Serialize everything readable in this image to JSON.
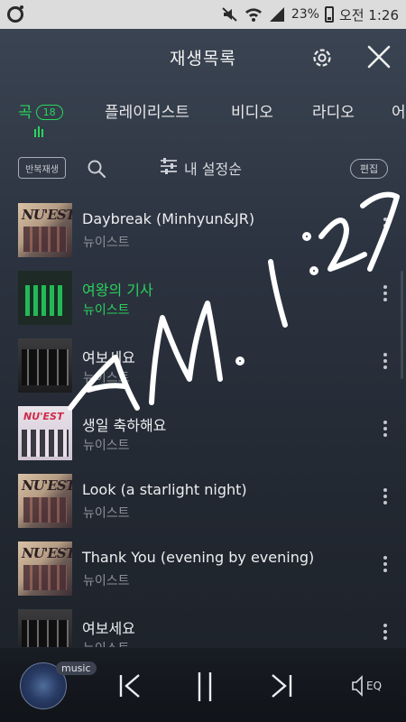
{
  "status_bar": {
    "battery": "23%",
    "time": "오전 1:26"
  },
  "header": {
    "title": "재생목록"
  },
  "tabs": [
    {
      "label": "곡",
      "count": "18",
      "active": true
    },
    {
      "label": "플레이리스트"
    },
    {
      "label": "비디오"
    },
    {
      "label": "라디오"
    },
    {
      "label": "어"
    }
  ],
  "toolbar": {
    "repeat_label": "반복재생",
    "sort_label": "내 설정순",
    "edit_label": "편집"
  },
  "songs": [
    {
      "title": "Daybreak (Minhyun&JR)",
      "artist": "뉴이스트",
      "art": "nuest",
      "art_text": "NU'EST"
    },
    {
      "title": "여왕의 기사",
      "artist": "뉴이스트",
      "art": "green",
      "playing": true
    },
    {
      "title": "여보세요",
      "artist": "뉴이스트",
      "art": "dark"
    },
    {
      "title": "생일 축하해요",
      "artist": "뉴이스트",
      "art": "bday",
      "art_text": "NU'EST"
    },
    {
      "title": "Look (a starlight night)",
      "artist": "뉴이스트",
      "art": "nuest",
      "art_text": "NU'EST"
    },
    {
      "title": "Thank You (evening by evening)",
      "artist": "뉴이스트",
      "art": "nuest",
      "art_text": "NU'EST"
    },
    {
      "title": "여보세요",
      "artist": "뉴이스트",
      "art": "dark"
    }
  ],
  "handwriting": "AM 1:27",
  "player": {
    "tag": "music",
    "eq_label": "EQ"
  },
  "colors": {
    "accent_green": "#28d75a"
  }
}
